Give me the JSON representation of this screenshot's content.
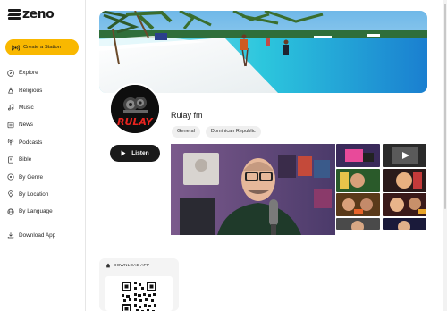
{
  "brand": {
    "name": "zeno"
  },
  "sidebar": {
    "create_label": "Create a Station",
    "items": [
      {
        "label": "Explore",
        "icon": "compass-icon"
      },
      {
        "label": "Religious",
        "icon": "religious-icon"
      },
      {
        "label": "Music",
        "icon": "music-note-icon"
      },
      {
        "label": "News",
        "icon": "news-icon"
      },
      {
        "label": "Podcasts",
        "icon": "podcast-icon"
      },
      {
        "label": "Bible",
        "icon": "book-icon"
      },
      {
        "label": "By Genre",
        "icon": "genre-icon"
      },
      {
        "label": "By Location",
        "icon": "location-pin-icon"
      },
      {
        "label": "By Language",
        "icon": "globe-icon"
      }
    ],
    "download_label": "Download App"
  },
  "station": {
    "name": "Rulay fm",
    "tags": [
      "General",
      "Dominican Republic"
    ],
    "listen_label": "Listen",
    "logo_text": "RULAY"
  },
  "download_card": {
    "title": "DOWNLOAD APP"
  },
  "colors": {
    "accent": "#f9b800",
    "dark": "#1a1a1a",
    "tag_bg": "#efefef"
  }
}
